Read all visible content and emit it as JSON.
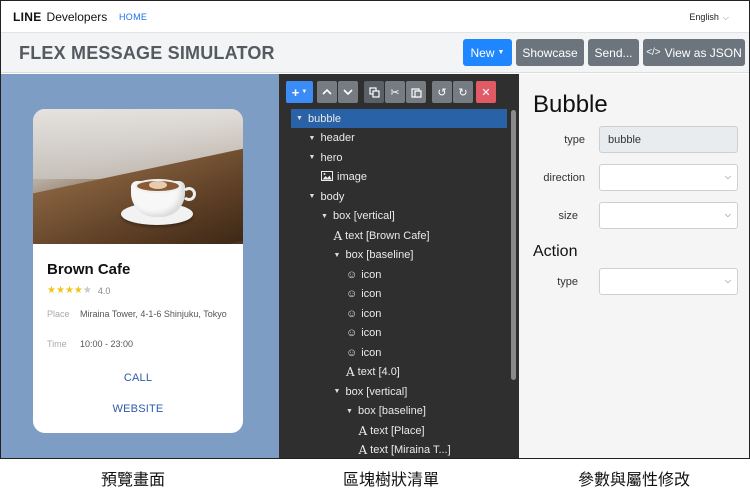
{
  "topnav": {
    "brand": "LINE",
    "brand_sub": "Developers",
    "home_link": "HOME",
    "language": "English"
  },
  "header": {
    "title": "FLEX MESSAGE SIMULATOR",
    "new_button": "New",
    "showcase_button": "Showcase",
    "send_button": "Send...",
    "json_button": "View as JSON"
  },
  "card": {
    "title": "Brown Cafe",
    "stars_filled": 4,
    "stars_total": 5,
    "rating": "4.0",
    "place_label": "Place",
    "place_value": "Miraina Tower, 4-1-6 Shinjuku, Tokyo",
    "time_label": "Time",
    "time_value": "10:00 - 23:00",
    "call_link": "CALL",
    "website_link": "WEBSITE"
  },
  "tree": {
    "toolbar": [
      "add-icon",
      "move-up-icon",
      "move-down-icon",
      "copy-icon",
      "cut-icon",
      "paste-icon",
      "undo-icon",
      "redo-icon",
      "delete-icon"
    ],
    "nodes": [
      {
        "label": "bubble",
        "kind": "branch",
        "depth": 0,
        "selected": true
      },
      {
        "label": "header",
        "kind": "branch",
        "depth": 1
      },
      {
        "label": "hero",
        "kind": "branch",
        "depth": 1
      },
      {
        "label": "image",
        "kind": "image",
        "depth": 2
      },
      {
        "label": "body",
        "kind": "branch",
        "depth": 1
      },
      {
        "label": "box [vertical]",
        "kind": "branch",
        "depth": 2
      },
      {
        "label": "text [Brown Cafe]",
        "kind": "text",
        "depth": 3
      },
      {
        "label": "box [baseline]",
        "kind": "branch",
        "depth": 3
      },
      {
        "label": "icon",
        "kind": "icon",
        "depth": 4
      },
      {
        "label": "icon",
        "kind": "icon",
        "depth": 4
      },
      {
        "label": "icon",
        "kind": "icon",
        "depth": 4
      },
      {
        "label": "icon",
        "kind": "icon",
        "depth": 4
      },
      {
        "label": "icon",
        "kind": "icon",
        "depth": 4
      },
      {
        "label": "text [4.0]",
        "kind": "text",
        "depth": 4
      },
      {
        "label": "box [vertical]",
        "kind": "branch",
        "depth": 3
      },
      {
        "label": "box [baseline]",
        "kind": "branch",
        "depth": 4
      },
      {
        "label": "text [Place]",
        "kind": "text",
        "depth": 5
      },
      {
        "label": "text [Miraina T...]",
        "kind": "text",
        "depth": 5
      }
    ]
  },
  "props": {
    "title": "Bubble",
    "type_label": "type",
    "type_value": "bubble",
    "direction_label": "direction",
    "direction_value": "",
    "size_label": "size",
    "size_value": "",
    "action_section": "Action",
    "action_type_label": "type",
    "action_type_value": ""
  },
  "captions": {
    "preview": "預覽畫面",
    "tree": "區塊樹狀清單",
    "props": "參數與屬性修改"
  },
  "colors": {
    "accent": "#1e86ff",
    "preview_bg": "#7e9dc4",
    "tree_bg": "#2f2f2f",
    "tree_selected": "#2a62a8",
    "link": "#2e5aa7",
    "star": "#f0c419",
    "delete": "#e05b66"
  }
}
